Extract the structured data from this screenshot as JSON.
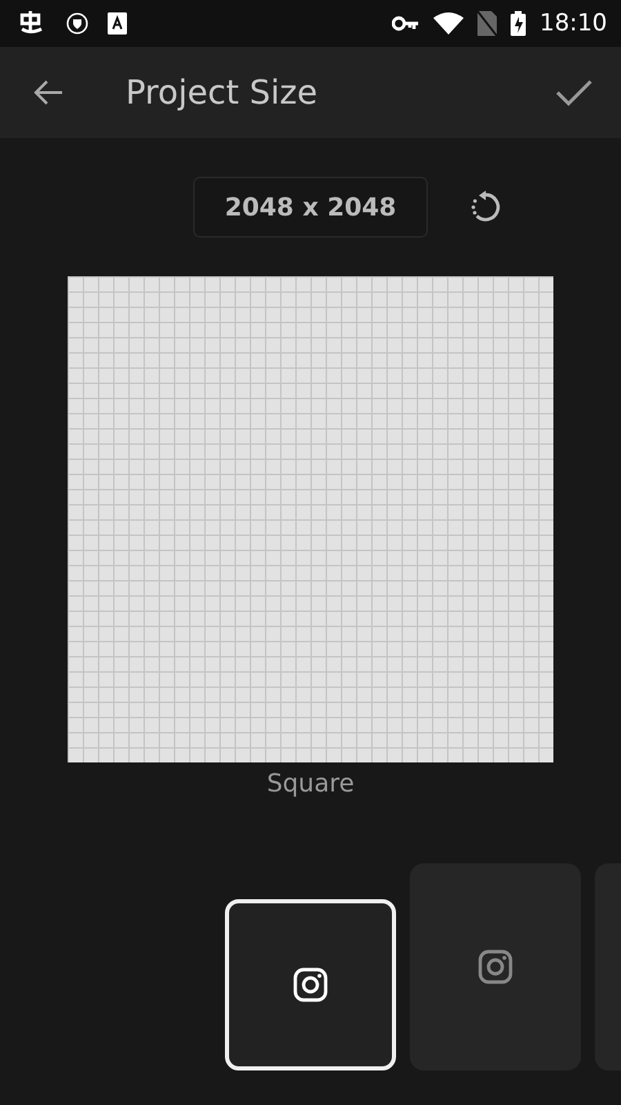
{
  "status_bar": {
    "time": "18:10"
  },
  "app_bar": {
    "title": "Project Size"
  },
  "size_label": "2048 x 2048",
  "canvas_label": "Square",
  "presets": [
    {
      "selected": true
    },
    {
      "selected": false
    },
    {
      "selected": false
    }
  ]
}
